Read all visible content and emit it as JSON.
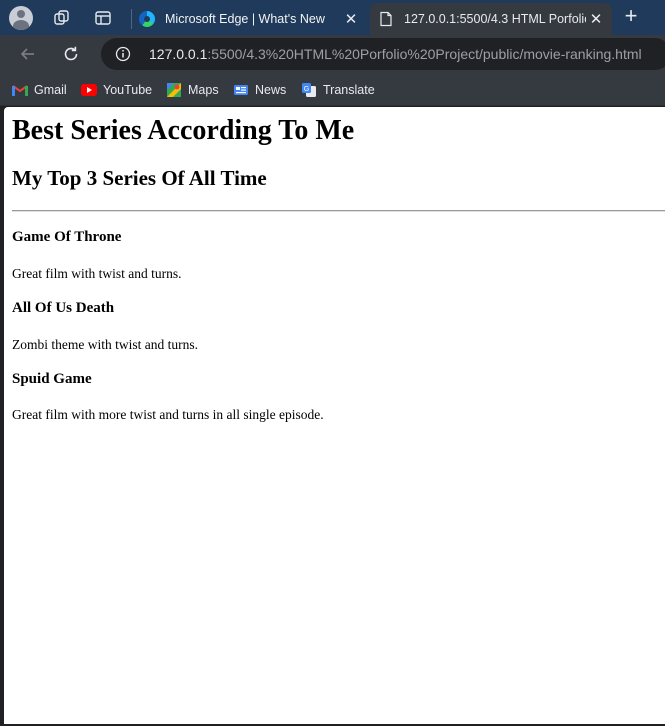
{
  "tabs": [
    {
      "title": "Microsoft Edge | What's New",
      "favicon": "edge-icon"
    },
    {
      "title": "127.0.0.1:5500/4.3 HTML Porfolio",
      "favicon": "page-icon"
    }
  ],
  "address": {
    "host": "127.0.0.1",
    "rest": ":5500/4.3%20HTML%20Porfolio%20Project/public/movie-ranking.html"
  },
  "bookmarks": [
    {
      "label": "Gmail",
      "icon": "gmail-icon"
    },
    {
      "label": "YouTube",
      "icon": "youtube-icon"
    },
    {
      "label": "Maps",
      "icon": "maps-icon"
    },
    {
      "label": "News",
      "icon": "news-icon"
    },
    {
      "label": "Translate",
      "icon": "translate-icon"
    }
  ],
  "page": {
    "title": "Best Series According To Me",
    "subtitle": "My Top 3 Series Of All Time",
    "series": [
      {
        "name": "Game Of Throne",
        "description": "Great film with twist and turns."
      },
      {
        "name": "All Of Us Death",
        "description": "Zombi theme with twist and turns."
      },
      {
        "name": "Spuid Game",
        "description": "Great film with more twist and turns in all single episode."
      }
    ]
  },
  "colors": {
    "tabstrip": "#1f3a5a",
    "toolbar": "#353a40",
    "omnibox": "#202124"
  }
}
